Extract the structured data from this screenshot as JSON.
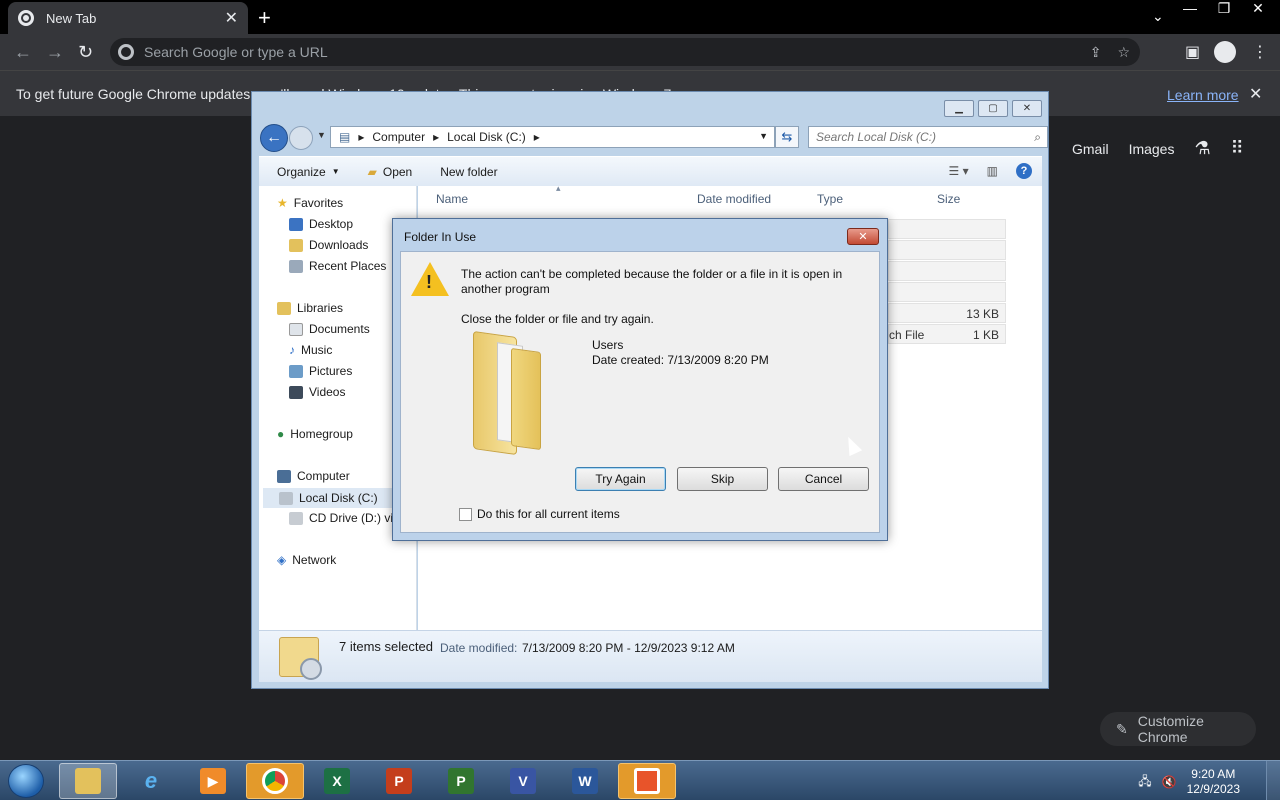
{
  "chrome": {
    "tab_title": "New Tab",
    "tab_close": "✕",
    "new_tab": "+",
    "omnibox_placeholder": "Search Google or type a URL",
    "infobar_message": "To get future Google Chrome updates, you'll need Windows 10 or later. This computer is using Windows 7.",
    "infobar_link": "Learn more",
    "ntp_links": [
      "Gmail",
      "Images"
    ],
    "customize_label": "Customize Chrome"
  },
  "explorer": {
    "breadcrumb": [
      "Computer",
      "Local Disk (C:)"
    ],
    "search_placeholder": "Search Local Disk (C:)",
    "commands": [
      "Organize",
      "Open",
      "New folder"
    ],
    "columns": [
      "Name",
      "Date modified",
      "Type",
      "Size"
    ],
    "visible_cells": [
      {
        "type": "",
        "size": "13 KB"
      },
      {
        "type": "ch File",
        "size": "1 KB"
      }
    ],
    "nav": {
      "favorites": "Favorites",
      "desktop": "Desktop",
      "downloads": "Downloads",
      "recent": "Recent Places",
      "libraries": "Libraries",
      "documents": "Documents",
      "music": "Music",
      "pictures": "Pictures",
      "videos": "Videos",
      "homegroup": "Homegroup",
      "computer": "Computer",
      "localdisk": "Local Disk (C:)",
      "cddrive": "CD Drive (D:) vir",
      "network": "Network"
    },
    "details": {
      "selected": "7 items selected",
      "date_label": "Date modified:",
      "date_value": "7/13/2009 8:20 PM - 12/9/2023 9:12 AM"
    }
  },
  "dialog": {
    "title": "Folder In Use",
    "message": "The action can't be completed because the folder or a file in it is open in another program",
    "hint": "Close the folder or file and try again.",
    "folder_name": "Users",
    "folder_date": "Date created: 7/13/2009 8:20 PM",
    "buttons": {
      "try_again": "Try Again",
      "skip": "Skip",
      "cancel": "Cancel"
    },
    "checkbox_label": "Do this for all current items"
  },
  "taskbar": {
    "time": "9:20 AM",
    "date": "12/9/2023",
    "apps": [
      "explorer",
      "internet-explorer",
      "media-player",
      "chrome",
      "excel",
      "powerpoint",
      "project",
      "visio",
      "word",
      "office"
    ]
  },
  "colors": {
    "chrome_dark": "#35363a",
    "link": "#8ab4f8",
    "win7_frame": "#bed3e8",
    "taskbar": "#2b4767"
  }
}
